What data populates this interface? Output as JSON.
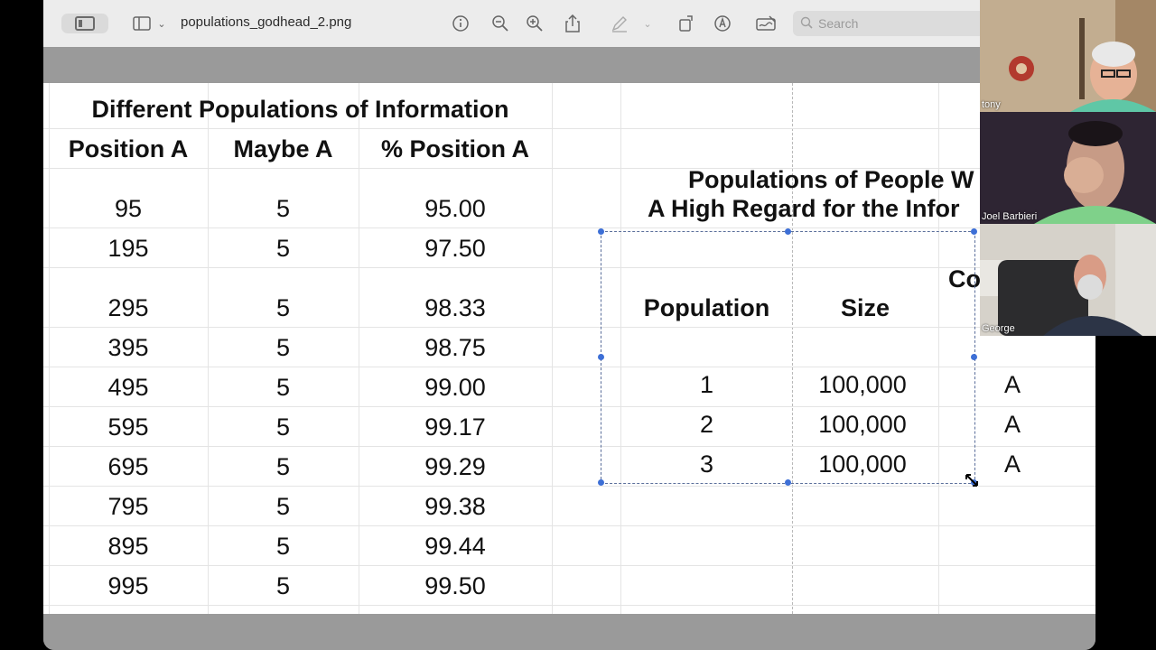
{
  "toolbar": {
    "filename": "populations_godhead_2.png",
    "search_placeholder": "Search"
  },
  "sheet": {
    "left_title": "Different Populations of Information",
    "left_headers": [
      "Position A",
      "Maybe A",
      "% Position A"
    ],
    "left_rows": [
      [
        "95",
        "5",
        "95.00"
      ],
      [
        "195",
        "5",
        "97.50"
      ],
      [
        "295",
        "5",
        "98.33"
      ],
      [
        "395",
        "5",
        "98.75"
      ],
      [
        "495",
        "5",
        "99.00"
      ],
      [
        "595",
        "5",
        "99.17"
      ],
      [
        "695",
        "5",
        "99.29"
      ],
      [
        "795",
        "5",
        "99.38"
      ],
      [
        "895",
        "5",
        "99.44"
      ],
      [
        "995",
        "5",
        "99.50"
      ]
    ],
    "right_title_line1": "Populations of People W",
    "right_title_line2": "A High Regard for the Infor",
    "right_headers": [
      "Population",
      "Size",
      "Co"
    ],
    "right_rows": [
      [
        "1",
        "100,000",
        "A"
      ],
      [
        "2",
        "100,000",
        "A"
      ],
      [
        "3",
        "100,000",
        "A"
      ]
    ]
  },
  "participants": [
    {
      "name": "tony"
    },
    {
      "name": "Joel Barbieri"
    },
    {
      "name": "George"
    }
  ]
}
